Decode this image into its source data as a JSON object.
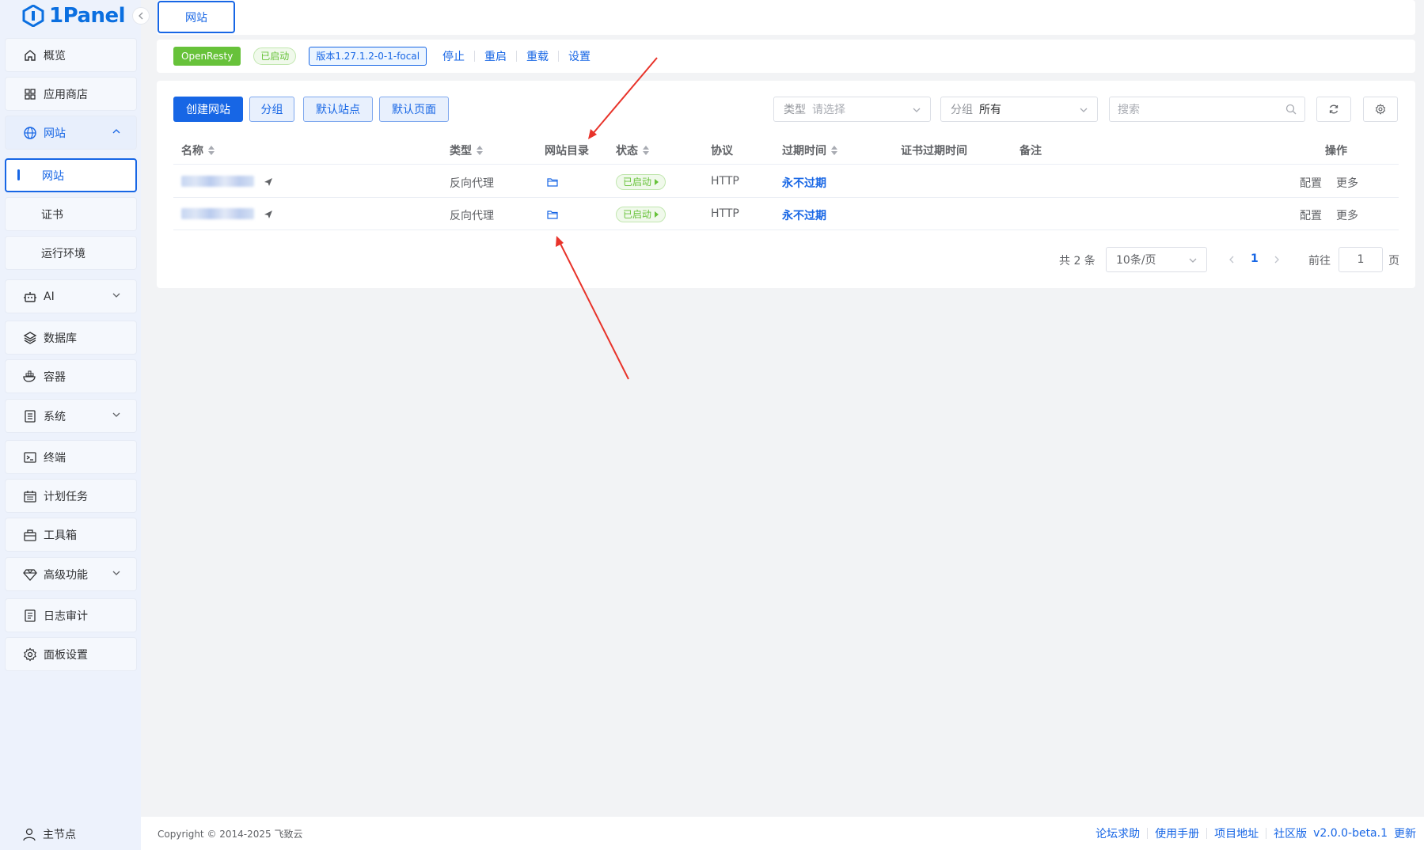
{
  "brand": {
    "name": "1Panel",
    "accent": "#1766e5"
  },
  "sidebar": {
    "items": [
      {
        "label": "概览",
        "icon": "home-icon"
      },
      {
        "label": "应用商店",
        "icon": "grid-icon"
      },
      {
        "label": "网站",
        "icon": "globe-icon",
        "expanded": true
      },
      {
        "label": "AI",
        "icon": "robot-icon"
      },
      {
        "label": "数据库",
        "icon": "layers-icon"
      },
      {
        "label": "容器",
        "icon": "docker-icon"
      },
      {
        "label": "系统",
        "icon": "server-icon"
      },
      {
        "label": "终端",
        "icon": "terminal-icon"
      },
      {
        "label": "计划任务",
        "icon": "calendar-icon"
      },
      {
        "label": "工具箱",
        "icon": "toolbox-icon"
      },
      {
        "label": "高级功能",
        "icon": "diamond-icon"
      },
      {
        "label": "日志审计",
        "icon": "log-icon"
      },
      {
        "label": "面板设置",
        "icon": "gear-icon"
      }
    ],
    "sub_items": [
      {
        "label": "网站",
        "active": true
      },
      {
        "label": "证书"
      },
      {
        "label": "运行环境"
      }
    ],
    "bottom_node": "主节点"
  },
  "tabs": [
    {
      "label": "网站"
    }
  ],
  "status": {
    "app": "OpenResty",
    "state": "已启动",
    "version": "版本1.27.1.2-0-1-focal",
    "actions": [
      "停止",
      "重启",
      "重载",
      "设置"
    ]
  },
  "toolbar": {
    "buttons": [
      "创建网站",
      "分组",
      "默认站点",
      "默认页面"
    ],
    "type_filter": {
      "prefix": "类型",
      "value": "请选择"
    },
    "group_filter": {
      "prefix": "分组",
      "value": "所有"
    },
    "search_placeholder": "搜索"
  },
  "table": {
    "columns": [
      "名称",
      "类型",
      "网站目录",
      "状态",
      "协议",
      "过期时间",
      "证书过期时间",
      "备注",
      "操作"
    ],
    "rows": [
      {
        "type": "反向代理",
        "status": "已启动",
        "protocol": "HTTP",
        "expire": "永不过期",
        "actions": [
          "配置",
          "更多"
        ]
      },
      {
        "type": "反向代理",
        "status": "已启动",
        "protocol": "HTTP",
        "expire": "永不过期",
        "actions": [
          "配置",
          "更多"
        ]
      }
    ]
  },
  "pagination": {
    "total": "共 2 条",
    "page_size": "10条/页",
    "current": "1",
    "goto_label": "前往",
    "goto_value": "1",
    "page_suffix": "页"
  },
  "footer": {
    "copyright": "Copyright © 2014-2025 飞致云",
    "links": [
      "论坛求助",
      "使用手册",
      "项目地址",
      "社区版"
    ],
    "version": "v2.0.0-beta.1",
    "update": "更新"
  }
}
